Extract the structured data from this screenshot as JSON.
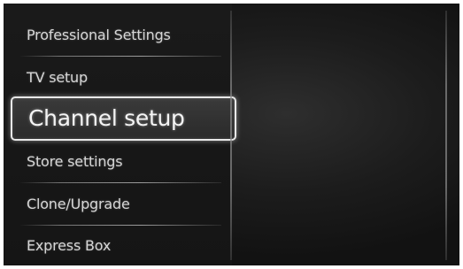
{
  "menu": {
    "items": [
      {
        "label": "Professional Settings"
      },
      {
        "label": "TV setup"
      },
      {
        "label": "Channel setup",
        "selected": true
      },
      {
        "label": "Store settings"
      },
      {
        "label": "Clone/Upgrade"
      },
      {
        "label": "Express Box"
      }
    ]
  },
  "colors": {
    "background": "#161616",
    "text": "#d6d6d6",
    "highlight_border": "#e8e8e8"
  }
}
